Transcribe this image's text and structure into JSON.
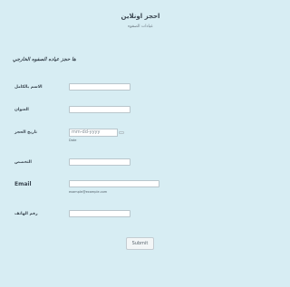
{
  "form": {
    "title": "احجز اونلاين",
    "subtitle": "عيادات الصفوه",
    "heading": "ها حجز عياده الصفوه الخارجي"
  },
  "fields": {
    "full_name_label": "الاسم بالكامل",
    "address_label": "العنوان",
    "date_label": "تاريخ الحجز",
    "date_placeholder": "mm-dd-yyyy",
    "date_sublabel": "Date",
    "specialty_label": "التخصص",
    "email_label": "Email",
    "email_sublabel": "example@example.com",
    "phone_label": "رقم الهاتف"
  },
  "actions": {
    "submit_label": "Submit"
  }
}
